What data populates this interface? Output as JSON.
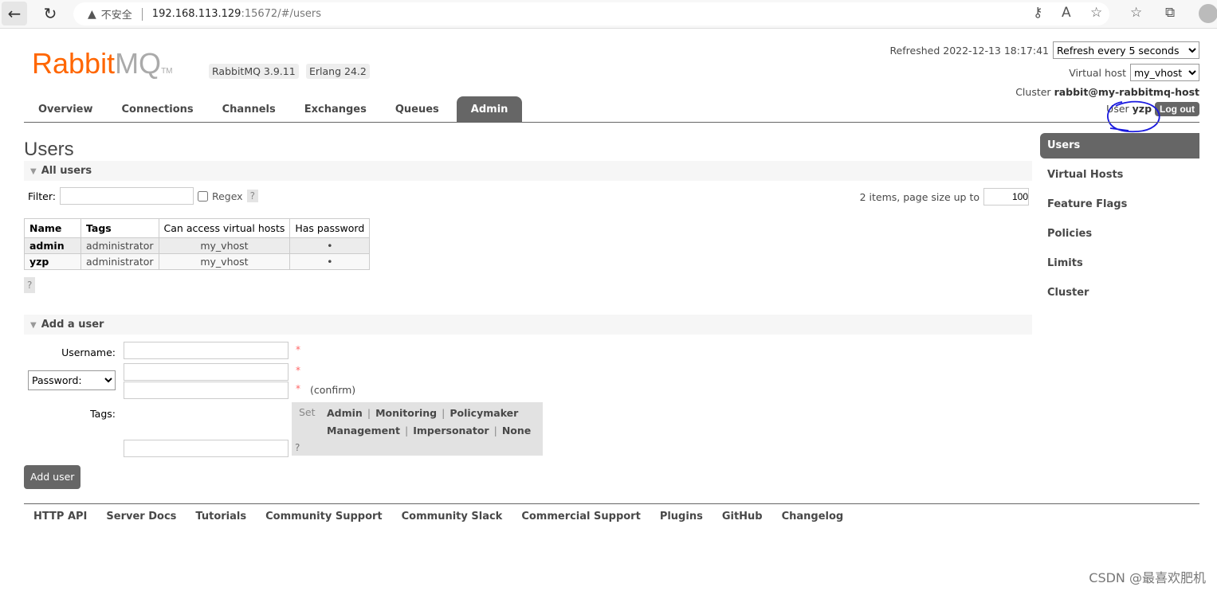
{
  "browser": {
    "security": "不安全",
    "url_host": "192.168.113.129",
    "url_rest": ":15672/#/users"
  },
  "header": {
    "logo_rabbit": "Rabbit",
    "logo_mq": "MQ",
    "logo_tm": "TM",
    "rabbitmq_version": "RabbitMQ 3.9.11",
    "erlang_version": "Erlang 24.2",
    "refreshed_label": "Refreshed 2022-12-13 18:17:41",
    "refresh_option": "Refresh every 5 seconds",
    "vhost_label": "Virtual host",
    "vhost_value": "my_vhost",
    "cluster_label": "Cluster",
    "cluster_value": "rabbit@my-rabbitmq-host",
    "user_label": "User",
    "user_value": "yzp",
    "logout": "Log out",
    "annotation_color": "#1a1adf"
  },
  "tabs": [
    "Overview",
    "Connections",
    "Channels",
    "Exchanges",
    "Queues",
    "Admin"
  ],
  "page_title": "Users",
  "all_users": {
    "title": "All users",
    "filter_label": "Filter:",
    "regex_label": "Regex",
    "help": "?",
    "items_text": "2 items, page size up to",
    "page_size": "100",
    "columns": [
      "Name",
      "Tags",
      "Can access virtual hosts",
      "Has password"
    ],
    "rows": [
      [
        "admin",
        "administrator",
        "my_vhost",
        "•"
      ],
      [
        "yzp",
        "administrator",
        "my_vhost",
        "•"
      ]
    ]
  },
  "add_user": {
    "title": "Add a user",
    "username_label": "Username:",
    "password_option": "Password:",
    "required": "*",
    "confirm": "(confirm)",
    "tags_label": "Tags:",
    "set_label": "Set",
    "tags": [
      "Admin",
      "Monitoring",
      "Policymaker",
      "Management",
      "Impersonator",
      "None"
    ],
    "help": "?",
    "button": "Add user"
  },
  "sidebar": [
    "Users",
    "Virtual Hosts",
    "Feature Flags",
    "Policies",
    "Limits",
    "Cluster"
  ],
  "footer": [
    "HTTP API",
    "Server Docs",
    "Tutorials",
    "Community Support",
    "Community Slack",
    "Commercial Support",
    "Plugins",
    "GitHub",
    "Changelog"
  ],
  "watermark": "CSDN @最喜欢肥机"
}
